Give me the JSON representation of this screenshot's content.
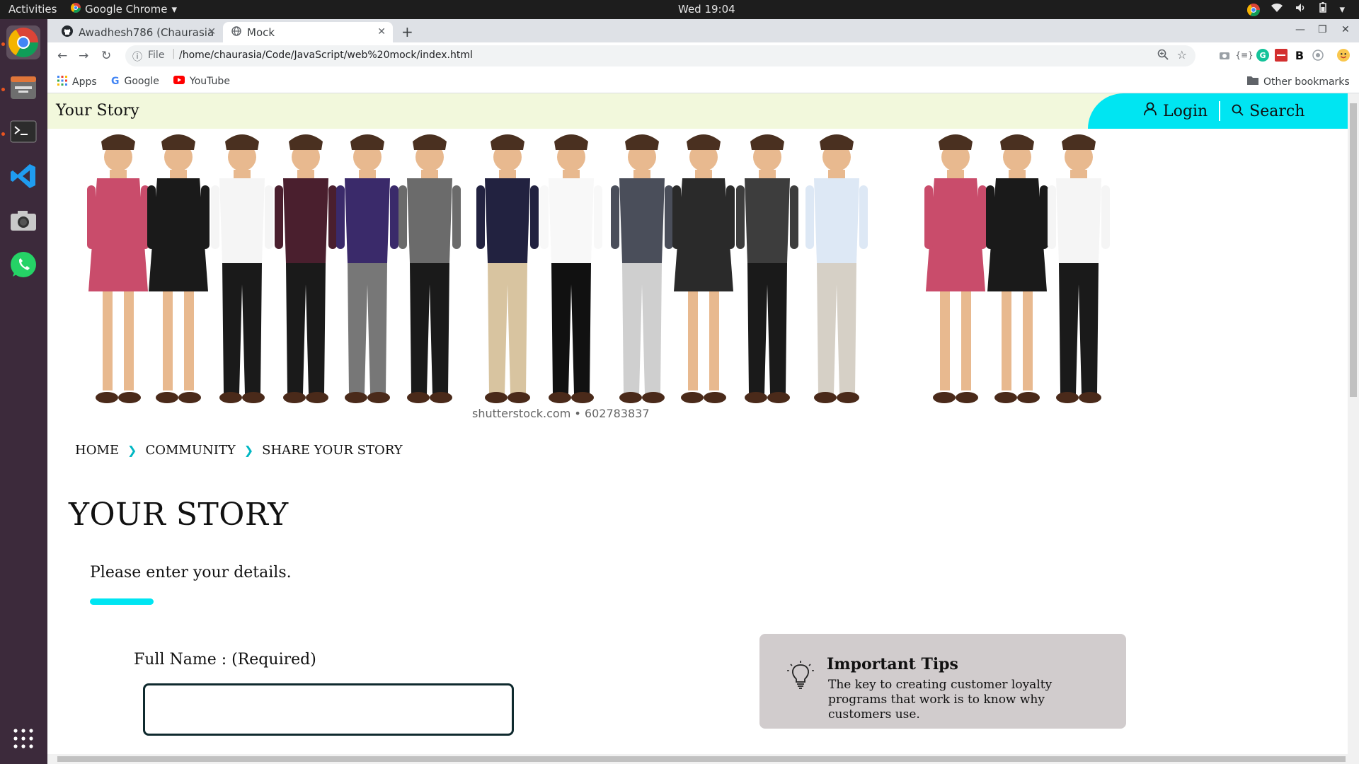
{
  "os_bar": {
    "activities": "Activities",
    "app_name": "Google Chrome",
    "clock": "Wed 19:04"
  },
  "dock": {
    "items": [
      "chrome-icon",
      "files-icon",
      "terminal-icon",
      "vscode-icon",
      "camera-icon",
      "whatsapp-icon",
      "app-grid-icon"
    ]
  },
  "browser": {
    "tabs": [
      {
        "label": "Awadhesh786 (Chaurasia"
      },
      {
        "label": "Mock"
      }
    ],
    "address": {
      "scheme": "File",
      "url": "/home/chaurasia/Code/JavaScript/web%20mock/index.html"
    },
    "bookmarks": [
      {
        "label": "Apps"
      },
      {
        "label": "Google"
      },
      {
        "label": "YouTube"
      }
    ],
    "other_bookmarks": "Other bookmarks"
  },
  "site": {
    "brand": "Your Story",
    "login": "Login",
    "search": "Search",
    "hero_watermark": "shutterstock.com • 602783837",
    "breadcrumb": [
      "HOME",
      "COMMUNITY",
      "SHARE YOUR STORY"
    ],
    "title": "YOUR STORY",
    "intro": "Please enter your details.",
    "form": {
      "fullname_label": "Full Name : (Required)",
      "fullname_value": ""
    },
    "tips": {
      "title": "Important Tips",
      "body": "The key to creating customer loyalty programs that work is to know why customers use."
    }
  },
  "colors": {
    "accent": "#00e5f2",
    "header_bg": "#f2f8dc",
    "tips_bg": "#d1cccd",
    "dock_bg": "#3c2a3b"
  }
}
